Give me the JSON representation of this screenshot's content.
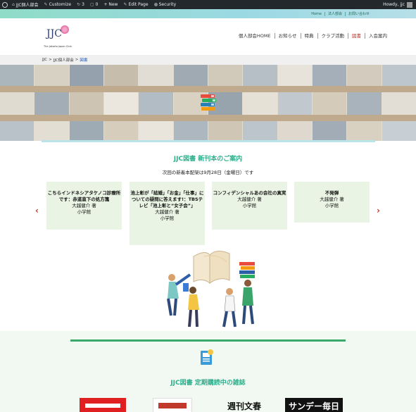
{
  "admin_bar": {
    "site_name": "JJC個人部会",
    "customize": "Customize",
    "updates": "3",
    "comments": "0",
    "new": "+ New",
    "edit_page": "Edit Page",
    "security": "Security",
    "howdy": "Howdy, jjc"
  },
  "top_links": [
    "Home",
    "法人部会",
    "お問い合わせ"
  ],
  "logo": {
    "text": "JJC",
    "tagline": "The Jakarta Japan Club"
  },
  "nav": [
    "個人部会HOME",
    "お知らせ",
    "特典",
    "クラブ活動",
    "図書",
    "入会案内"
  ],
  "nav_active_index": 4,
  "breadcrumb": {
    "items": [
      "JJC",
      "JJC個人部会",
      "図書"
    ],
    "separator": ">"
  },
  "new_books": {
    "title": "JJC図書 新刊本のご案内",
    "subtitle": "次回の新着本配架は9月28日（金曜日）です",
    "cards": [
      {
        "title": "こちらインドネシアタケノコ診療所です：赤道直下の処方箋",
        "author": "大越健介 著",
        "publisher": "小学館"
      },
      {
        "title": "池上彰が「結婚」「お金」「仕事」についての疑問に答えます!：TBSテレビ「池上彰と“女子会”」",
        "author": "大越健介 著",
        "publisher": "小学館"
      },
      {
        "title": "コンフィデンシャルあの会社の真実",
        "author": "大越健介 著",
        "publisher": "小学館"
      },
      {
        "title": "不発弾",
        "author": "大越健介 著",
        "publisher": "小学館"
      }
    ],
    "prev_icon": "chevron-left-icon",
    "next_icon": "chevron-right-icon"
  },
  "magazines": {
    "title": "JJC図書 定期購読中の雑誌",
    "logos": [
      "週刊文春",
      "サンデー毎日"
    ]
  },
  "colors": {
    "accent_green": "#2db08c",
    "nav_active": "#c0392b",
    "card_bg": "#eaf4e4",
    "admin_bg": "#23282d"
  }
}
